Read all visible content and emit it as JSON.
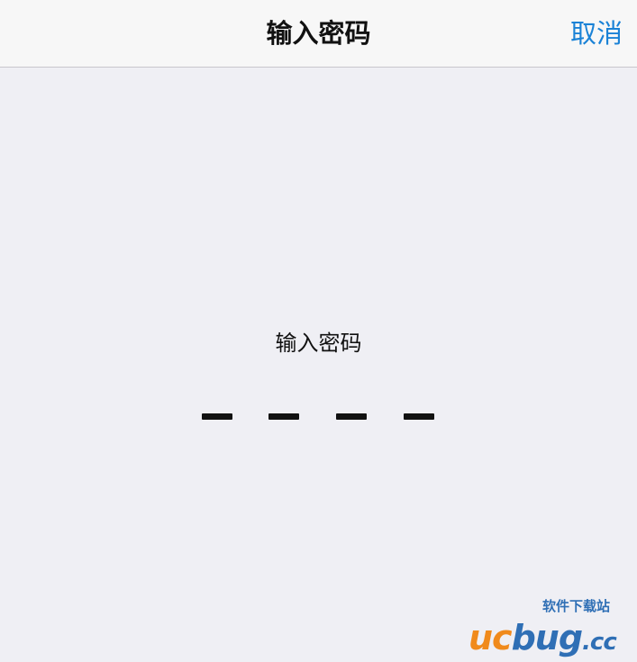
{
  "nav": {
    "title": "输入密码",
    "cancel_label": "取消"
  },
  "prompt": {
    "text": "输入密码"
  },
  "passcode": {
    "length": 4,
    "entered": 0
  },
  "watermark": {
    "tagline": "软件下载站",
    "logo_uc": "uc",
    "logo_bug": "bug",
    "logo_cc": ".cc"
  },
  "colors": {
    "background": "#efeff4",
    "nav_background": "#f7f7f7",
    "accent": "#1a82d6",
    "text": "#111111",
    "watermark_orange": "#f08a1c",
    "watermark_blue": "#2f6fb5"
  }
}
